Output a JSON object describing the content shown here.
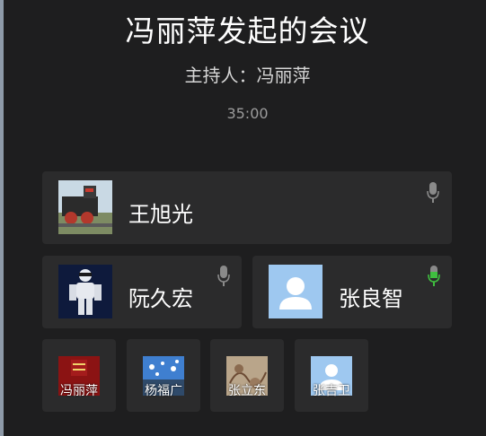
{
  "meeting": {
    "title": "冯丽萍发起的会议",
    "host": "主持人：冯丽萍",
    "timer": "35:00"
  },
  "participants": [
    {
      "name": "王旭光",
      "avatar": "train-photo",
      "mic": "muted"
    },
    {
      "name": "阮久宏",
      "avatar": "robot-photo",
      "mic": "muted"
    },
    {
      "name": "张良智",
      "avatar": "default-person-icon",
      "mic": "active"
    },
    {
      "name": "冯丽萍",
      "avatar": "red-poster-photo"
    },
    {
      "name": "杨福广",
      "avatar": "sky-photo"
    },
    {
      "name": "张立东",
      "avatar": "drawing-photo"
    },
    {
      "name": "张吉卫",
      "avatar": "default-person-icon"
    }
  ],
  "colors": {
    "background": "#1e1e1f",
    "card": "#2b2b2c",
    "mic_muted": "#8a8a8a",
    "mic_active": "#3fbf3f",
    "default_avatar": "#9ec8f0"
  }
}
